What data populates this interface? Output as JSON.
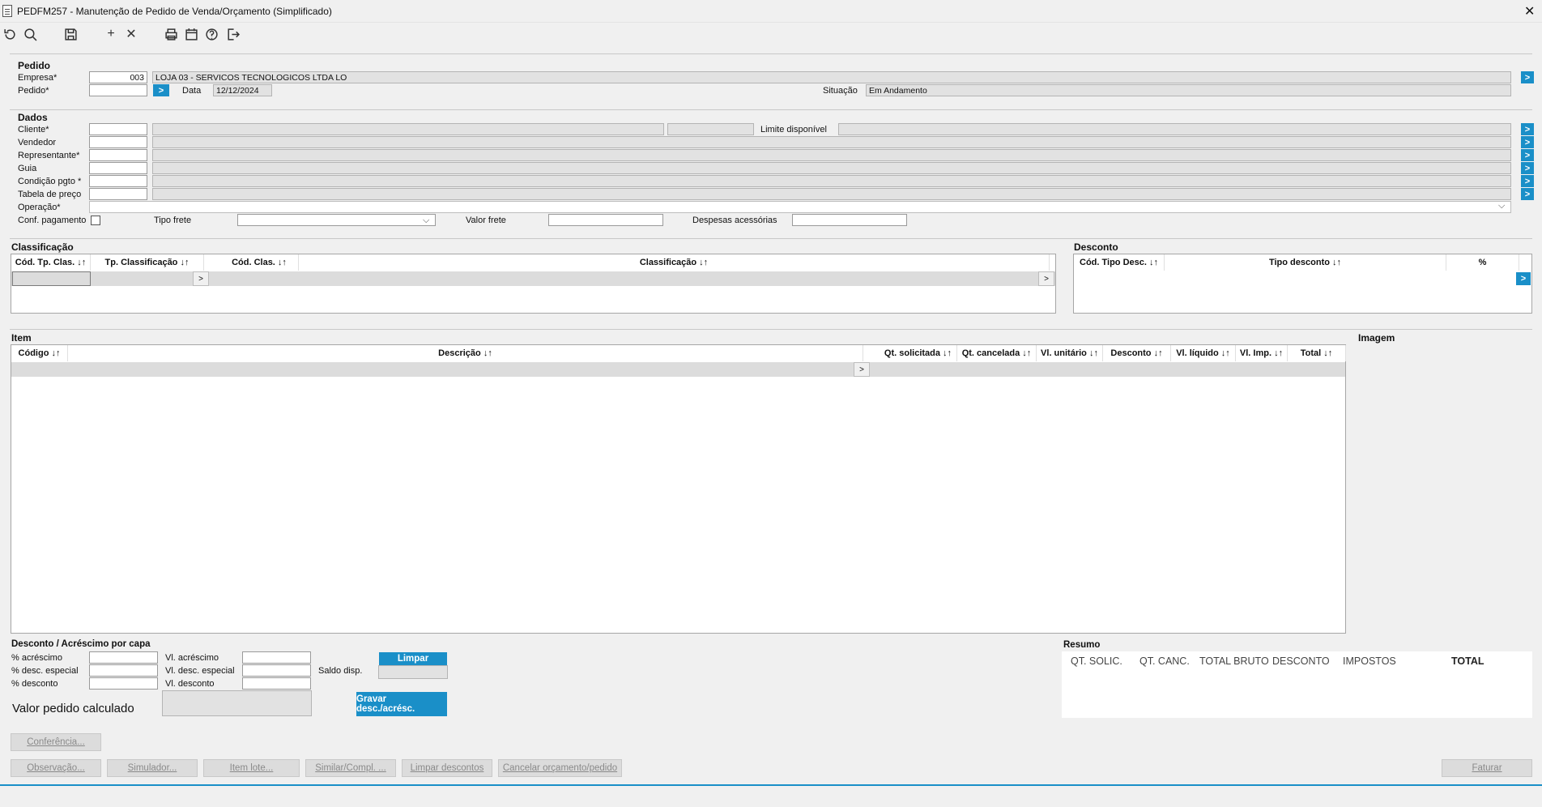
{
  "window": {
    "title": "PEDFM257 - Manutenção de Pedido de Venda/Orçamento (Simplificado)",
    "close": "✕"
  },
  "toolbar": {
    "icons": [
      "undo-icon",
      "search-icon",
      "save-icon",
      "add-icon",
      "close-icon",
      "print-icon",
      "calendar-icon",
      "help-icon",
      "exit-icon"
    ],
    "add_glyph": "+",
    "delete_glyph": "✕"
  },
  "pedido": {
    "section": "Pedido",
    "empresa_label": "Empresa*",
    "empresa_code": "003",
    "empresa_name": "LOJA 03 - SERVICOS TECNOLOGICOS LTDA   LO",
    "pedido_label": "Pedido*",
    "pedido_value": "",
    "data_label": "Data",
    "data_value": "12/12/2024",
    "situacao_label": "Situação",
    "situacao_value": "Em Andamento"
  },
  "dados": {
    "section": "Dados",
    "cliente": "Cliente*",
    "limite": "Limite disponível",
    "vendedor": "Vendedor",
    "representante": "Representante*",
    "guia": "Guia",
    "condicao": "Condição pgto *",
    "tabela": "Tabela de preço",
    "operacao": "Operação*",
    "conf_pagamento": "Conf. pagamento",
    "tipo_frete": "Tipo frete",
    "valor_frete": "Valor frete",
    "despesas": "Despesas acessórias"
  },
  "classificacao": {
    "section": "Classificação",
    "columns": [
      "Cód. Tp. Clas. ↓↑",
      "Tp. Classificação ↓↑",
      "Cód. Clas. ↓↑",
      "Classificação ↓↑"
    ]
  },
  "desconto": {
    "section": "Desconto",
    "columns": [
      "Cód. Tipo Desc. ↓↑",
      "Tipo desconto ↓↑",
      "%"
    ]
  },
  "item": {
    "section": "Item",
    "imagem": "Imagem",
    "columns": [
      "Código ↓↑",
      "Descrição ↓↑",
      "Qt. solicitada ↓↑",
      "Qt. cancelada ↓↑",
      "Vl. unitário ↓↑",
      "Desconto ↓↑",
      "Vl. líquido ↓↑",
      "Vl. Imp. ↓↑",
      "Total ↓↑"
    ]
  },
  "capa": {
    "section": "Desconto / Acréscimo por capa",
    "pct_acrescimo": "% acréscimo",
    "pct_desc_especial": "% desc. especial",
    "pct_desconto": "% desconto",
    "vl_acrescimo": "Vl. acréscimo",
    "vl_desc_especial": "Vl. desc. especial",
    "vl_desconto": "Vl. desconto",
    "saldo": "Saldo disp.",
    "limpar": "Limpar",
    "gravar": "Gravar desc./acrésc.",
    "valor_calculado": "Valor pedido calculado"
  },
  "resumo": {
    "section": "Resumo",
    "columns": [
      "QT. SOLIC.",
      "QT. CANC.",
      "TOTAL BRUTO",
      "DESCONTO",
      "IMPOSTOS",
      "TOTAL"
    ]
  },
  "buttons": {
    "conferencia": "Conferência...",
    "observacao": "Observação...",
    "simulador": "Simulador...",
    "item_lote": "Item lote...",
    "similar": "Similar/Compl. ...",
    "limpar_descontos": "Limpar descontos",
    "cancelar": "Cancelar orçamento/pedido",
    "faturar": "Faturar"
  },
  "grid_glyphs": {
    "row_button": ">",
    "lookup": ">"
  },
  "colors": {
    "accent": "#1a8fc8",
    "background": "#f0f0f0"
  }
}
